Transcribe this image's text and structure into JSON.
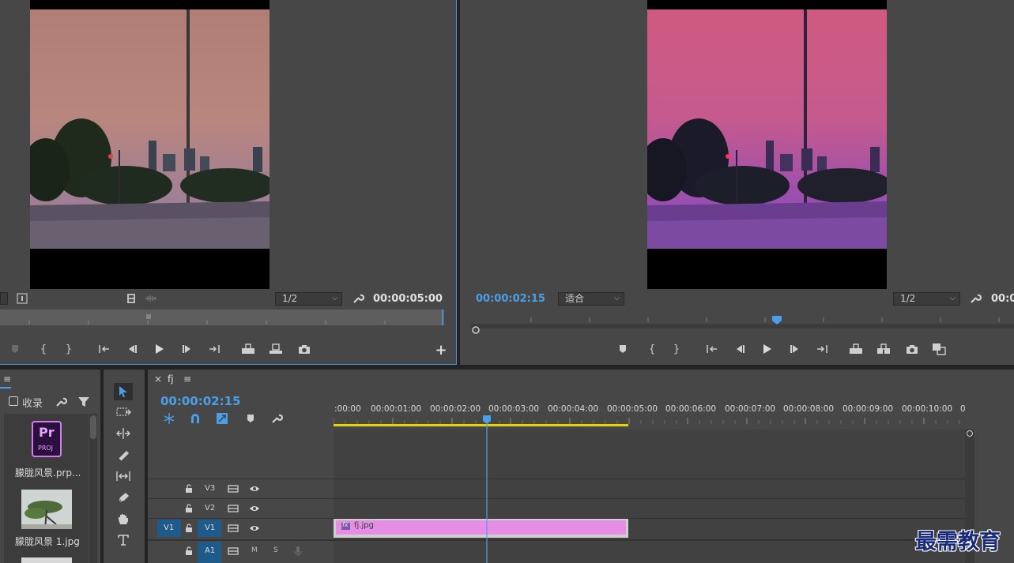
{
  "source_monitor": {
    "resolution": "1/2",
    "timecode": "00:00:05:00"
  },
  "program_monitor": {
    "timecode": "00:00:02:15",
    "fit": "适合",
    "resolution": "1/2",
    "timecode_right": "00:0"
  },
  "project_panel": {
    "menu_glyph": "≡",
    "favorites_label": "收录",
    "items": [
      {
        "name": "朦胧风景.prp...",
        "badge": "Pr",
        "badge_sub": "PROJ"
      },
      {
        "name": "朦胧风景 1.jpg"
      }
    ]
  },
  "timeline": {
    "close_glyph": "×",
    "sequence_name": "fj",
    "menu_glyph": "≡",
    "timecode": "00:00:02:15",
    "ruler_labels": [
      ":00:00",
      "00:00:01:00",
      "00:00:02:00",
      "00:00:03:00",
      "00:00:04:00",
      "00:00:05:00",
      "00:00:06:00",
      "00:00:07:00",
      "00:00:08:00",
      "00:00:09:00",
      "00:00:10:00",
      "0"
    ],
    "tracks": [
      {
        "name": "V3"
      },
      {
        "name": "V2"
      },
      {
        "name": "V1",
        "source": "V1"
      },
      {
        "name": "A1",
        "m": "M",
        "s": "S"
      }
    ],
    "clip": {
      "fx": "fx",
      "name": "fj.jpg",
      "color": "#e68ee6"
    }
  },
  "watermark": "最需教育",
  "colors": {
    "accent": "#4b9fe8",
    "panel_bg": "#474747",
    "clip": "#e68ee6",
    "work_area": "#e9d400"
  }
}
